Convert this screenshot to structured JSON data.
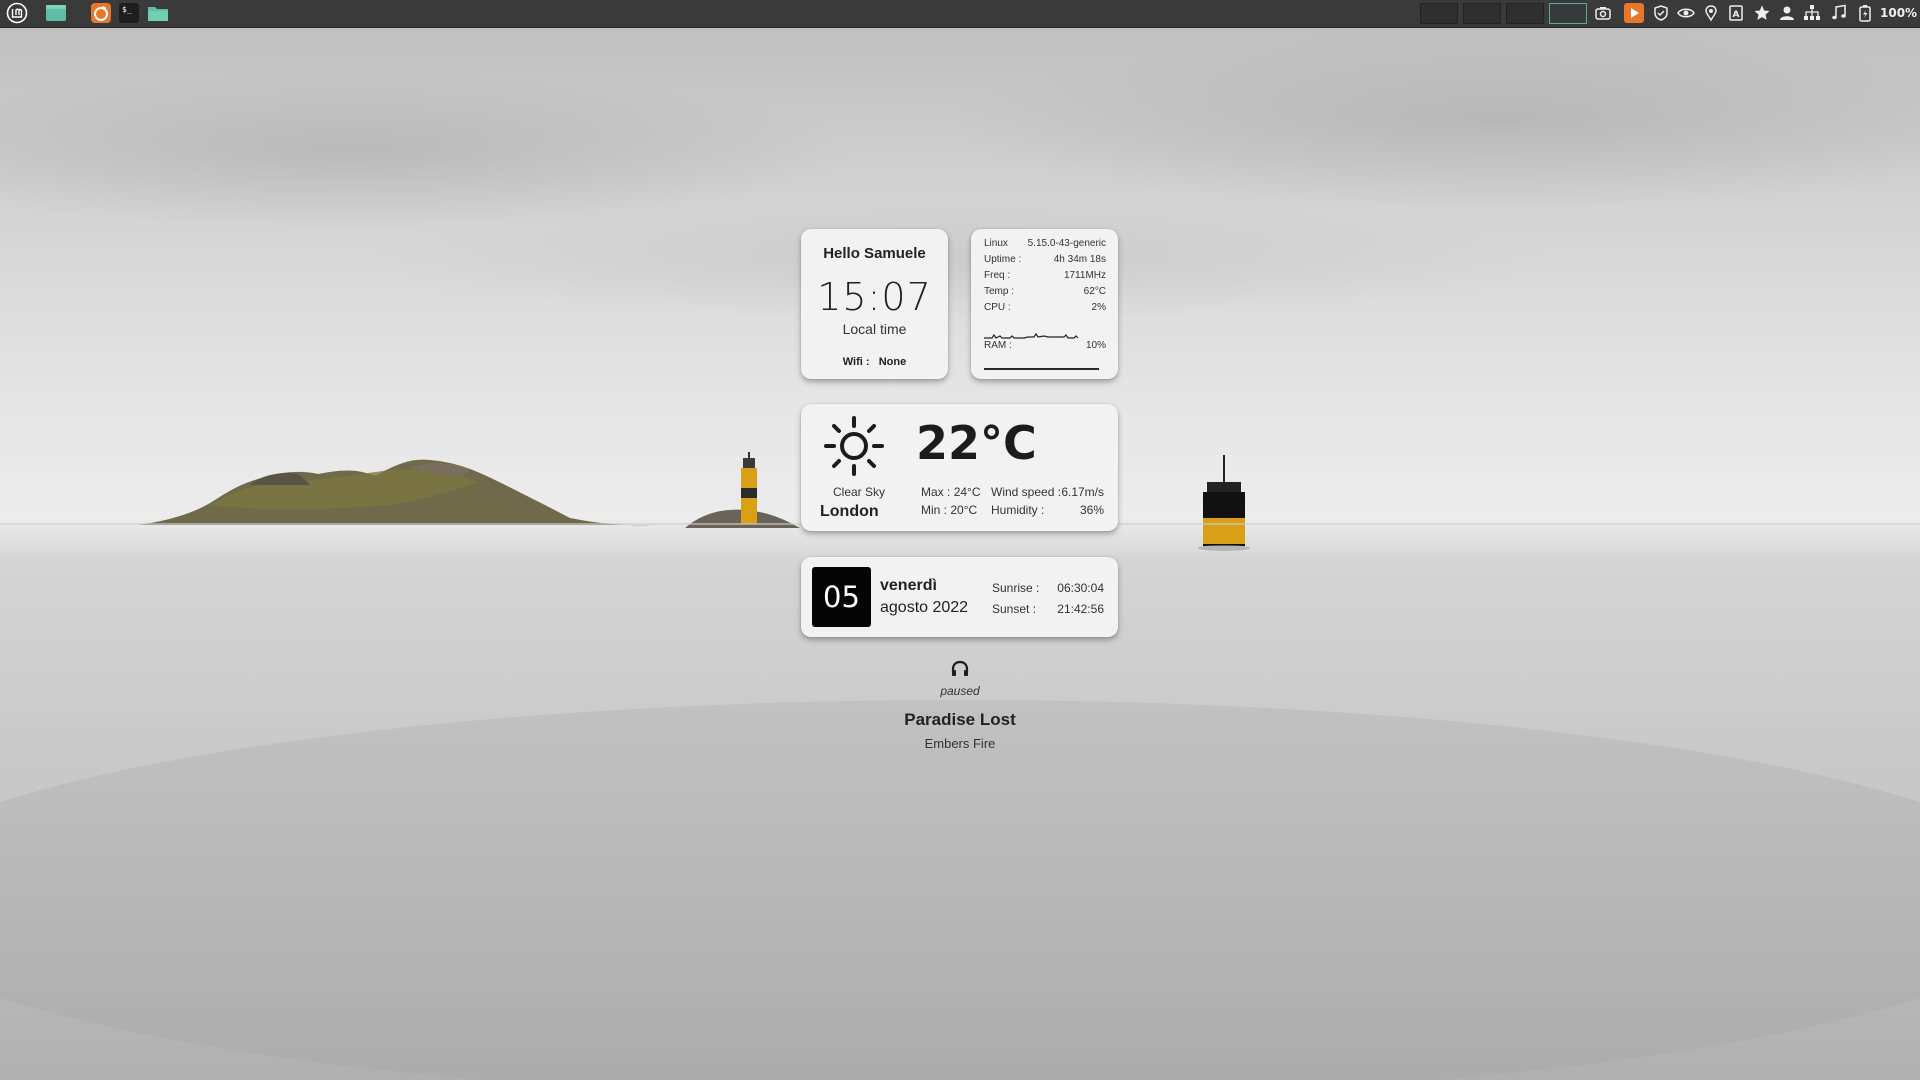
{
  "panel": {
    "launchers": [
      {
        "icon": "mint-menu-icon"
      },
      {
        "icon": "show-desktop-icon"
      },
      {
        "icon": "firefox-icon"
      },
      {
        "icon": "terminal-icon"
      },
      {
        "icon": "files-icon"
      }
    ],
    "workspaces": 4,
    "active_workspace": 4,
    "tray": [
      "screenshot-icon",
      "media-player-icon",
      "shield-icon",
      "eye-icon",
      "location-icon",
      "document-icon",
      "star-icon",
      "user-icon",
      "network-icon",
      "music-note-icon",
      "battery-icon"
    ],
    "battery": "100%"
  },
  "greeting_widget": {
    "greeting": "Hello Samuele",
    "time": "15:07",
    "time_label": "Local time",
    "wifi_label": "Wifi :",
    "wifi_value": "None"
  },
  "system_widget": {
    "rows": [
      {
        "key": "Linux",
        "value": "5.15.0-43-generic"
      },
      {
        "key": "Uptime :",
        "value": "4h 34m 18s"
      },
      {
        "key": "Freq :",
        "value": "1711MHz"
      },
      {
        "key": "Temp :",
        "value": "62°C"
      },
      {
        "key": "CPU :",
        "value": "2%"
      }
    ],
    "ram_label": "RAM :",
    "ram_value": "10%",
    "ram_fraction": 0.1
  },
  "weather_widget": {
    "icon": "sun-icon",
    "temperature": "22°C",
    "condition": "Clear Sky",
    "city": "London",
    "max_label": "Max :",
    "max_value": "24°C",
    "min_label": "Min :",
    "min_value": "20°C",
    "wind_label": "Wind speed :",
    "wind_value": "6.17m/s",
    "humidity_label": "Humidity :",
    "humidity_value": "36%"
  },
  "date_widget": {
    "day": "05",
    "weekday": "venerdì",
    "month_year": "agosto 2022",
    "sunrise_label": "Sunrise :",
    "sunrise_value": "06:30:04",
    "sunset_label": "Sunset :",
    "sunset_value": "21:42:56"
  },
  "media_widget": {
    "icon": "headphones-icon",
    "status": "paused",
    "title": "Paradise Lost",
    "artist": "Embers Fire"
  },
  "colors": {
    "panel_bg": "#3a3a3a",
    "accent_green": "#5fbfa5",
    "accent_orange": "#e8762b",
    "card_bg": "#f2f2f2",
    "lighthouse_yellow": "#d9a017"
  }
}
